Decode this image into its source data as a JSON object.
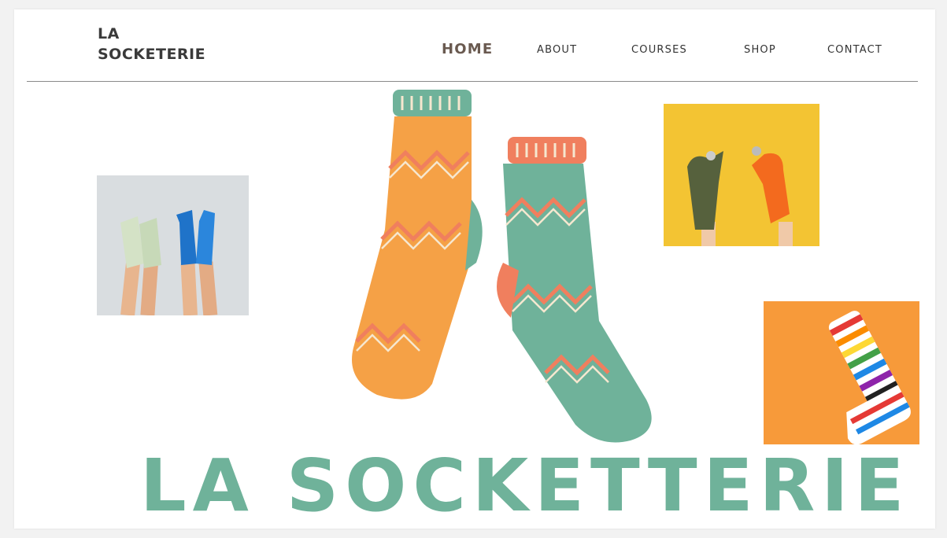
{
  "brand": {
    "logo_line1": "LA",
    "logo_line2": "SOCKETERIE",
    "hero_title": "LA SOCKETTERIE"
  },
  "nav": {
    "items": [
      {
        "label": "HOME",
        "active": true
      },
      {
        "label": "ABOUT",
        "active": false
      },
      {
        "label": "COURSES",
        "active": false
      },
      {
        "label": "SHOP",
        "active": false
      },
      {
        "label": "CONTACT",
        "active": false
      }
    ]
  },
  "colors": {
    "brand_green": "#6fb29a",
    "sock_orange": "#f5a146",
    "sock_coral": "#f07f5e",
    "sock_cream": "#f6e7cf"
  },
  "images": {
    "legs_socks": "photo-legs-socks",
    "sock_puppets": "photo-sock-puppets",
    "rainbow_sock": "photo-rainbow-sock",
    "hero_illustration": "socks-illustration"
  }
}
